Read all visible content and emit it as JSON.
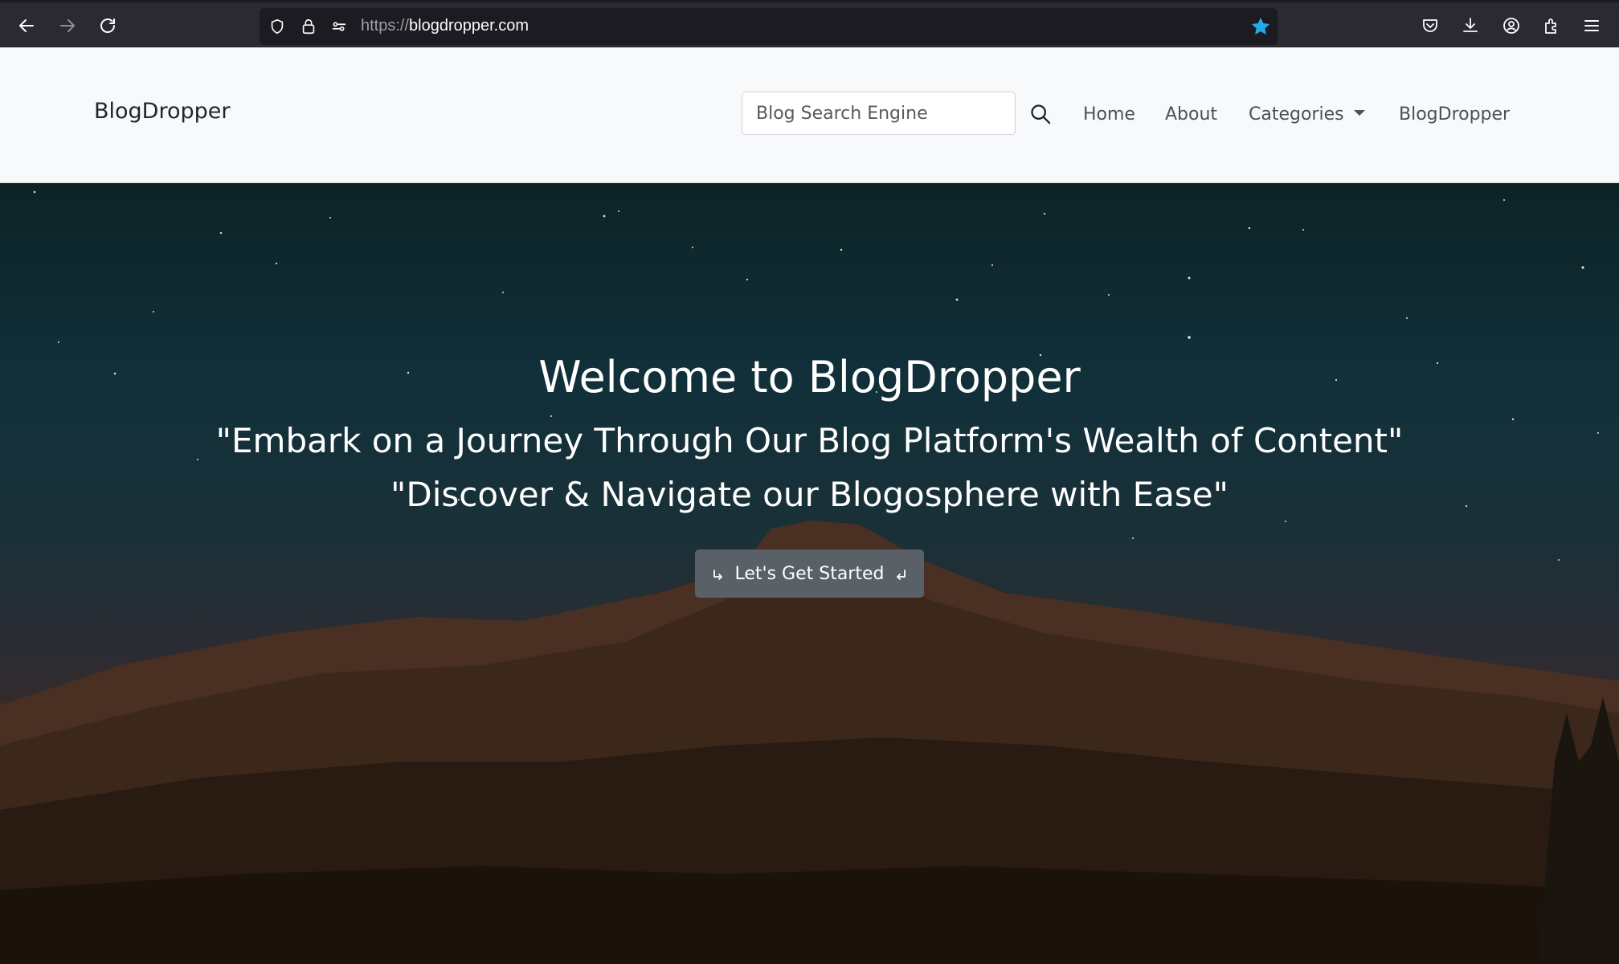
{
  "browser": {
    "url_scheme": "https://",
    "url_host": "blogdropper.com",
    "bookmark_color": "#25a8e8",
    "icons": [
      "back-icon",
      "forward-icon",
      "reload-icon",
      "shield-icon",
      "lock-icon",
      "permissions-icon",
      "star-icon",
      "pocket-icon",
      "download-icon",
      "account-icon",
      "extensions-icon",
      "menu-icon"
    ]
  },
  "navbar": {
    "brand": "BlogDropper",
    "search_placeholder": "Blog Search Engine",
    "links": {
      "home": "Home",
      "about": "About",
      "categories": "Categories",
      "blogdropper": "BlogDropper"
    }
  },
  "hero": {
    "title": "Welcome to BlogDropper",
    "line1": "\"Embark on a Journey Through Our Blog Platform's Wealth of Content\"",
    "line2": "\"Discover & Navigate our Blogosphere with Ease\"",
    "cta_label": "Let's Get Started"
  },
  "colors": {
    "chrome_bg": "#2b2a33",
    "navbar_bg": "#f8f9fa",
    "cta_bg": "#5a6068"
  }
}
